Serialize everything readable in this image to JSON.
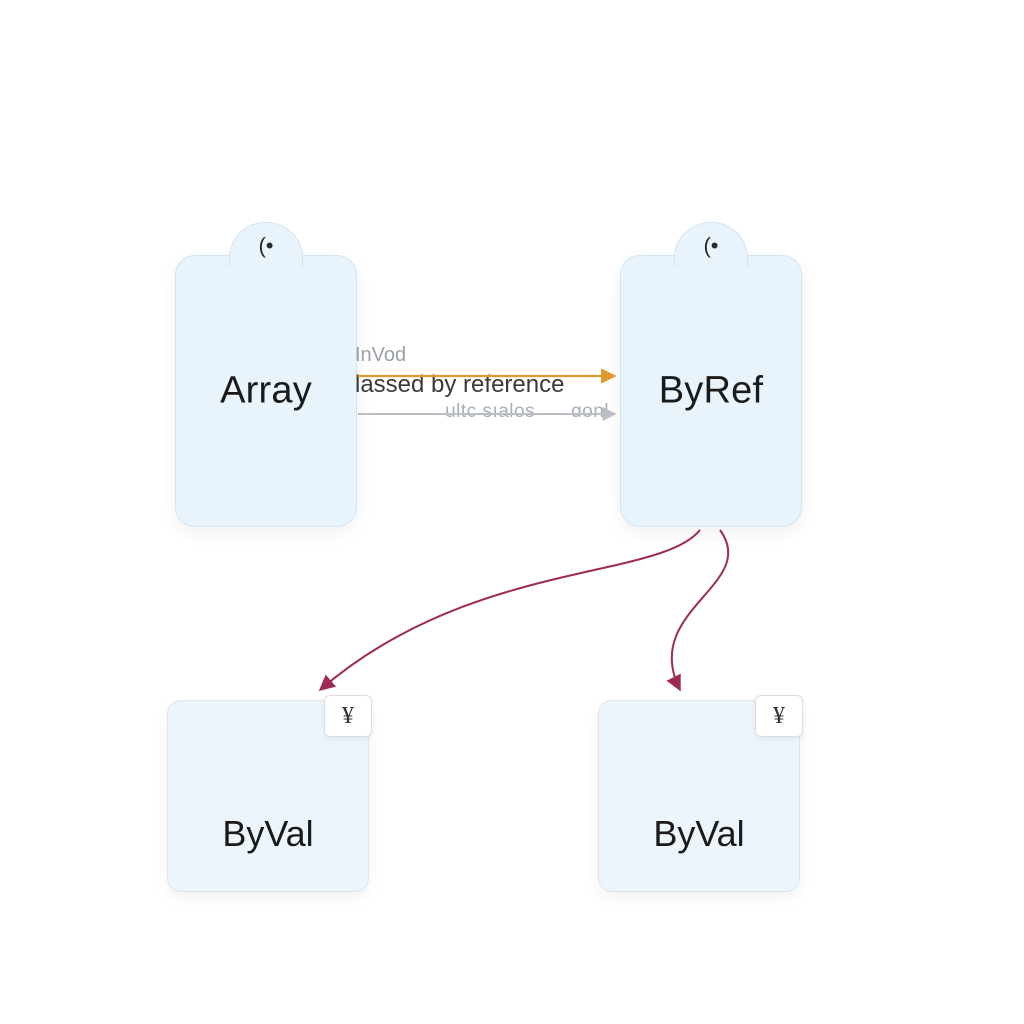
{
  "nodes": {
    "array": {
      "label": "Array",
      "hole": "(•"
    },
    "byref": {
      "label": "ByRef",
      "hole": "(•"
    },
    "byval1": {
      "label": "ByVal",
      "badge": "¥"
    },
    "byval2": {
      "label": "ByVal",
      "badge": "¥"
    }
  },
  "center": {
    "top": "InVod",
    "middle": "lassed by reference",
    "bottomA": "ultc sıalos",
    "bottomB": "ɑonl"
  },
  "colors": {
    "arrow_orange": "#e09a2b",
    "arrow_gray": "#b9bfc5",
    "arrow_maroon": "#9e2a56"
  }
}
